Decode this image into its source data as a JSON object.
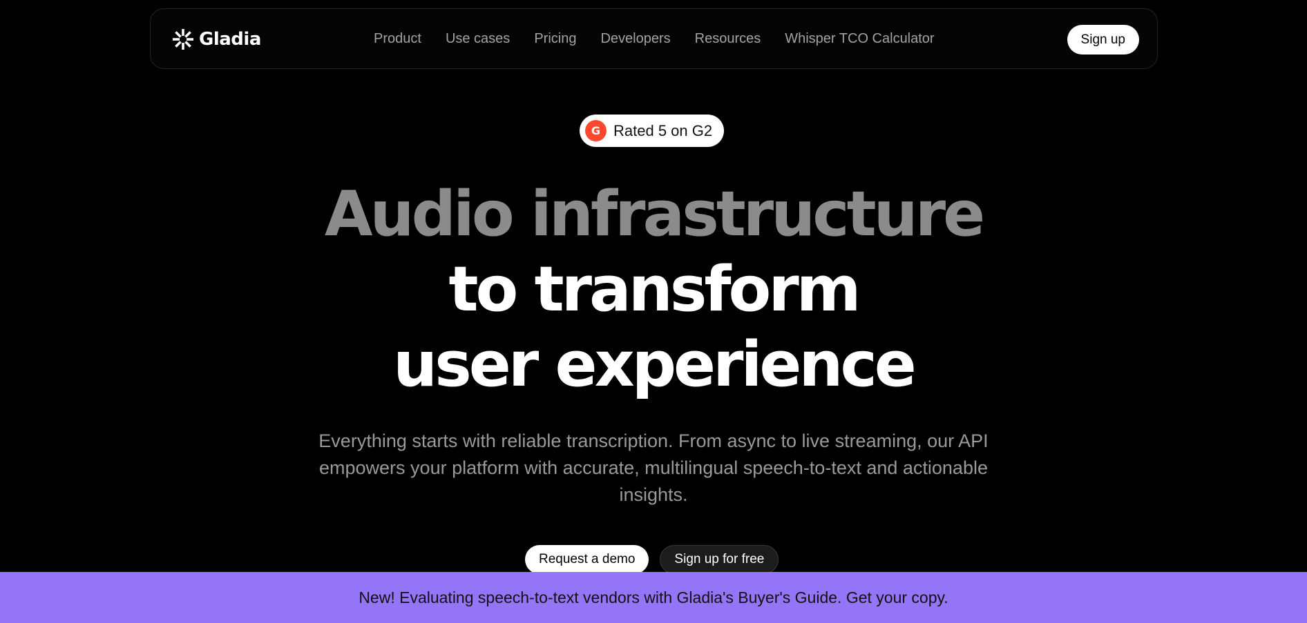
{
  "brand": {
    "name": "Gladia",
    "logo_icon": "starburst-icon"
  },
  "nav": {
    "items": [
      {
        "label": "Product"
      },
      {
        "label": "Use cases"
      },
      {
        "label": "Pricing"
      },
      {
        "label": "Developers"
      },
      {
        "label": "Resources"
      },
      {
        "label": "Whisper TCO Calculator"
      }
    ],
    "signup_label": "Sign up"
  },
  "badge": {
    "icon": "g2-icon",
    "icon_letter": "G",
    "label": "Rated 5 on G2"
  },
  "hero": {
    "line1": "Audio infrastructure",
    "line2": "to transform",
    "line3": "user experience",
    "subtitle": "Everything starts with reliable transcription. From async to live streaming, our API empowers your platform with accurate, multilingual speech-to-text and actionable insights."
  },
  "cta": {
    "demo_label": "Request a demo",
    "signup_label": "Sign up for free"
  },
  "banner": {
    "text": "New! Evaluating speech-to-text vendors with Gladia's Buyer's Guide. Get your copy."
  },
  "colors": {
    "background": "#000000",
    "banner": "#9474f7",
    "g2_red": "#ff492c",
    "hero_grey": "#8b8b8b"
  }
}
